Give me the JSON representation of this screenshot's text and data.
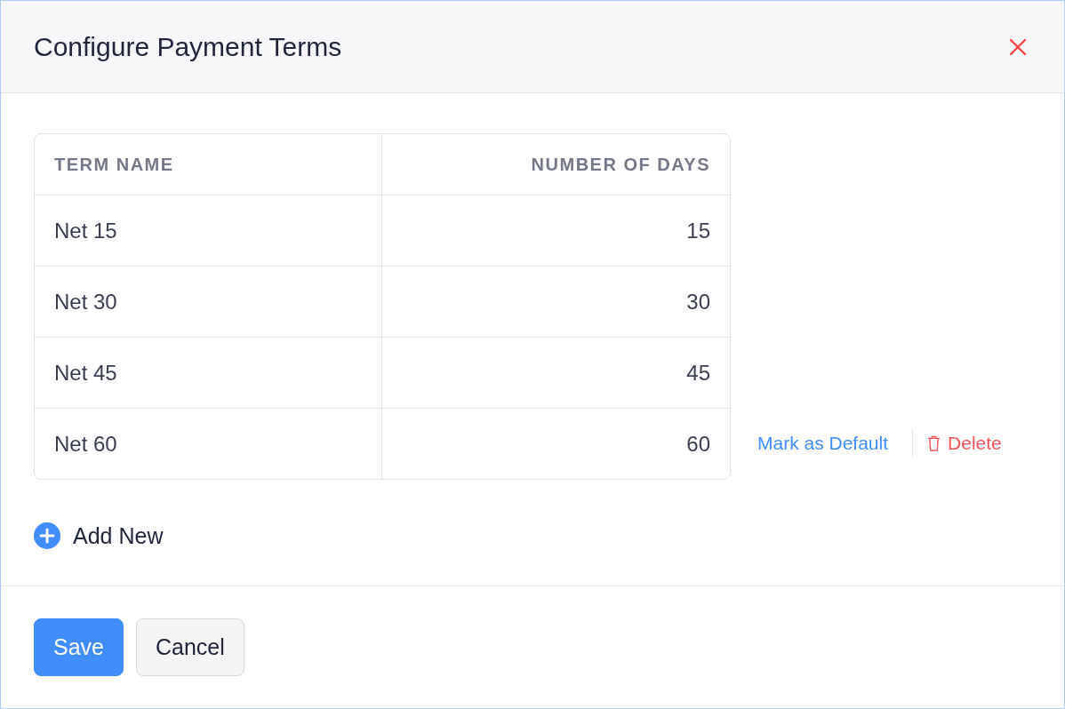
{
  "dialog": {
    "title": "Configure Payment Terms"
  },
  "table": {
    "columns": [
      {
        "label": "TERM NAME",
        "kind": "text"
      },
      {
        "label": "NUMBER OF DAYS",
        "kind": "number"
      }
    ],
    "rows": [
      {
        "cells": [
          "Net 15",
          "15"
        ],
        "actions": []
      },
      {
        "cells": [
          "Net 30",
          "30"
        ],
        "actions": []
      },
      {
        "cells": [
          "Net 45",
          "45"
        ],
        "actions": []
      },
      {
        "cells": [
          "Net 60",
          "60"
        ],
        "actions": [
          {
            "kind": "link",
            "label": "Mark as Default"
          },
          {
            "kind": "delete",
            "label": "Delete"
          }
        ]
      }
    ]
  },
  "add_new": {
    "label": "Add New"
  },
  "buttons": [
    {
      "label": "Save",
      "kind": "primary"
    },
    {
      "label": "Cancel",
      "kind": "secondary"
    }
  ]
}
